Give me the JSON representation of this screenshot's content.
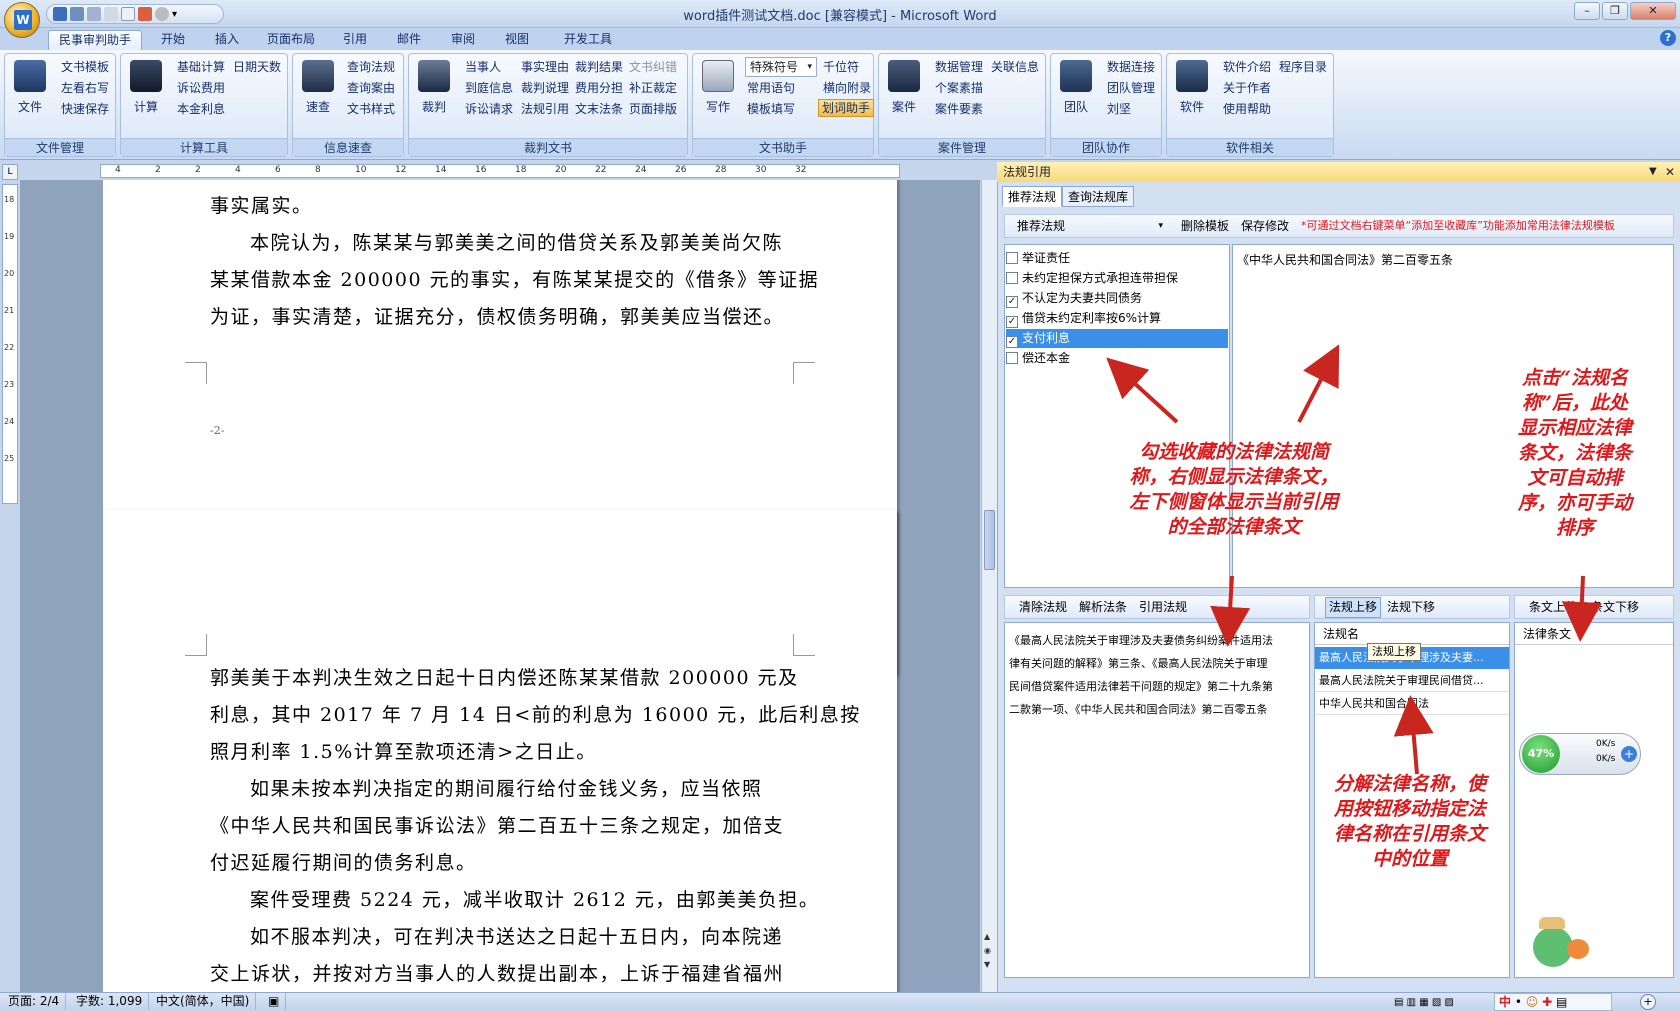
{
  "window": {
    "title": "word插件测试文档.doc [兼容模式] - Microsoft Word"
  },
  "tabs": [
    "民事审判助手",
    "开始",
    "插入",
    "页面布局",
    "引用",
    "邮件",
    "审阅",
    "视图",
    "开发工具"
  ],
  "ribbon": {
    "file": {
      "big": "文件",
      "items": [
        "文书模板",
        "左看右写",
        "快速保存"
      ],
      "label": "文件管理"
    },
    "calc": {
      "big": "计算",
      "items": [
        "基础计算",
        "日期天数",
        "诉讼费用",
        "本金利息"
      ],
      "label": "计算工具"
    },
    "info": {
      "big": "速查",
      "items": [
        "查询法规",
        "查询案由",
        "文书样式"
      ],
      "label": "信息速查"
    },
    "judge": {
      "big": "裁判",
      "items": [
        "当事人",
        "事实理由",
        "裁判结果",
        "文书纠错",
        "到庭信息",
        "裁判说理",
        "费用分担",
        "补正裁定",
        "诉讼请求",
        "法规引用",
        "文末法条",
        "页面排版"
      ],
      "label": "裁判文书"
    },
    "write": {
      "big": "写作",
      "combo": "特殊符号",
      "items": [
        "千位符",
        "常用语句",
        "横向附录",
        "模板填写",
        "划词助手"
      ],
      "label": "文书助手"
    },
    "case": {
      "big": "案件",
      "items": [
        "数据管理",
        "关联信息",
        "个案素描",
        "案件要素"
      ],
      "label": "案件管理"
    },
    "team": {
      "big": "团队",
      "items": [
        "数据连接",
        "团队管理",
        "刘坚"
      ],
      "label": "团队协作"
    },
    "soft": {
      "big": "软件",
      "items": [
        "软件介绍",
        "程序目录",
        "关于作者",
        "使用帮助"
      ],
      "label": "软件相关"
    }
  },
  "ruler_numbers": [
    "4",
    "2",
    "2",
    "4",
    "6",
    "8",
    "10",
    "12",
    "14",
    "16",
    "18",
    "20",
    "22",
    "24",
    "26",
    "28",
    "30",
    "32"
  ],
  "vruler_numbers": [
    "18",
    "19",
    "20",
    "21",
    "22",
    "23",
    "24",
    "25"
  ],
  "document": {
    "page1": [
      "事实属实。",
      "本院认为，陈某某与郭美美之间的借贷关系及郭美美尚欠陈",
      "某某借款本金 200000 元的事实，有陈某某提交的《借条》等证据",
      "为证，事实清楚，证据充分，债权债务明确，郭美美应当偿还。"
    ],
    "page_number": "-2-",
    "page2": [
      "郭美美于本判决生效之日起十日内偿还陈某某借款 200000 元及",
      "利息，其中 2017 年 7 月 14 日<前的利息为 16000 元，此后利息按",
      "照月利率 1.5%计算至款项还清>之日止。",
      "如果未按本判决指定的期间履行给付金钱义务，应当依照",
      "《中华人民共和国民事诉讼法》第二百五十三条之规定，加倍支",
      "付迟延履行期间的债务利息。",
      "案件受理费 5224 元，减半收取计 2612 元，由郭美美负担。",
      "如不服本判决，可在判决书送达之日起十五日内，向本院递",
      "交上诉状，并按对方当事人的人数提出副本，上诉于福建省福州"
    ]
  },
  "pane": {
    "title": "法规引用",
    "tabs": [
      "推荐法规",
      "查询法规库"
    ],
    "toolbar": {
      "combo": "推荐法规",
      "delete": "删除模板",
      "save": "保存修改",
      "hint": "*可通过文档右键菜单“添加至收藏库”功能添加常用法律法规模板"
    },
    "checks": [
      {
        "label": "举证责任",
        "checked": "",
        "sel": false
      },
      {
        "label": "未约定担保方式承担连带担保",
        "checked": "",
        "sel": false
      },
      {
        "label": "不认定为夫妻共同债务",
        "checked": "✓",
        "sel": false
      },
      {
        "label": "借贷未约定利率按6%计算",
        "checked": "✓",
        "sel": false
      },
      {
        "label": "支付利息",
        "checked": "✓",
        "sel": true
      },
      {
        "label": "偿还本金",
        "checked": "",
        "sel": false
      }
    ],
    "law_text": "《中华人民共和国合同法》第二百零五条",
    "btm_toolbar": [
      "清除法规",
      "解析法条",
      "引用法规"
    ],
    "cited_text": [
      "《最高人民法院关于审理涉及夫妻债务纠纷案件适用法",
      "律有关问题的解释》第三条、《最高人民法院关于审理",
      "民间借贷案件适用法律若干问题的规定》第二十九条第",
      "二款第一项、《中华人民共和国合同法》第二百零五条"
    ],
    "mid_toolbar": [
      "法规上移",
      "法规下移"
    ],
    "law_header": "法规名",
    "law_rows": [
      "最高人民法院关于审理涉及夫妻...",
      "最高人民法院关于审理民间借贷...",
      "中华人民共和国合同法"
    ],
    "tooltip": "法规上移",
    "right_toolbar": [
      "条文上移",
      "条文下移"
    ],
    "art_header": "法律条文",
    "speed": {
      "pct": "47%",
      "up": "0K/s",
      "down": "0K/s"
    }
  },
  "annotations": {
    "a1": [
      "勾选收藏的法律法规简",
      "称，右侧显示法律条文，",
      "左下侧窗体显示当前引用",
      "的全部法律条文"
    ],
    "a2": [
      "点击“法规名",
      "称”后，此处",
      "显示相应法律",
      "条文，法律条",
      "文可自动排",
      "序，亦可手动",
      "排序"
    ],
    "a3": [
      "分解法律名称，使",
      "用按钮移动指定法",
      "律名称在引用条文",
      "中的位置"
    ]
  },
  "status": {
    "page": "页面: 2/4",
    "words": "字数: 1,099",
    "lang": "中文(简体，中国)",
    "tray": [
      "中",
      "•",
      "☺",
      "✚",
      "▤"
    ]
  },
  "colors": {
    "accent": "#2a6fcd",
    "annotation": "#e0181a",
    "selection": "#3a8fe8"
  }
}
